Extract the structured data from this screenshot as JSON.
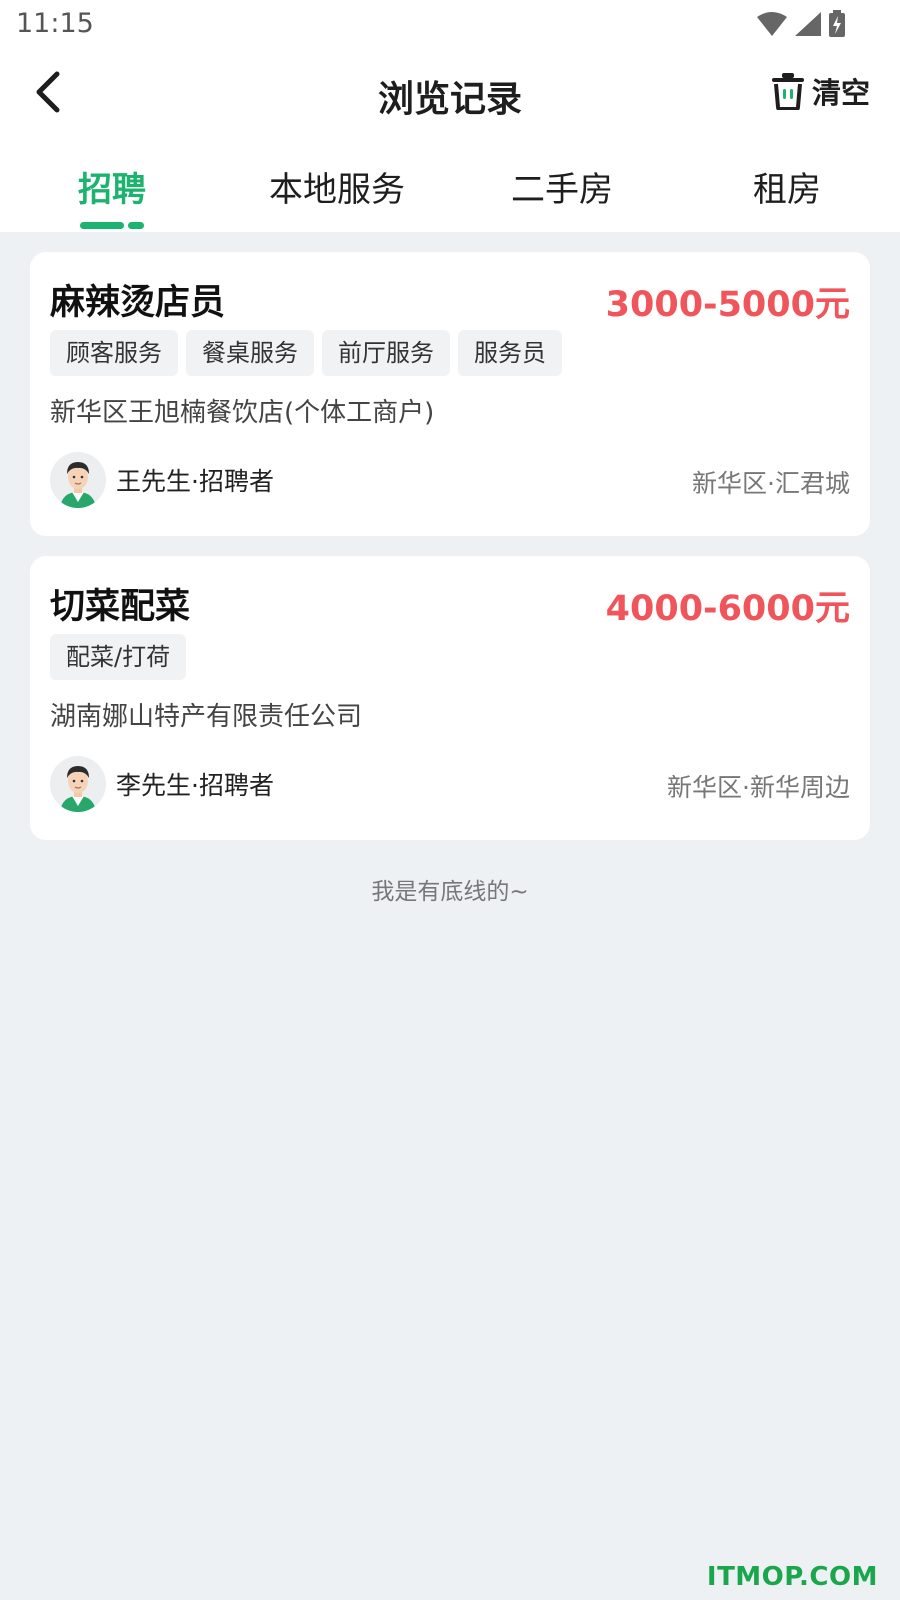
{
  "status_bar": {
    "time": "11:15"
  },
  "nav": {
    "title": "浏览记录",
    "clear_label": "清空"
  },
  "tabs": [
    {
      "label": "招聘",
      "active": true
    },
    {
      "label": "本地服务",
      "active": false
    },
    {
      "label": "二手房",
      "active": false
    },
    {
      "label": "租房",
      "active": false
    }
  ],
  "jobs": [
    {
      "title": "麻辣烫店员",
      "salary": "3000-5000元",
      "tags": [
        "顾客服务",
        "餐桌服务",
        "前厅服务",
        "服务员"
      ],
      "company": "新华区王旭楠餐饮店(个体工商户)",
      "recruiter": "王先生·招聘者",
      "location": "新华区·汇君城"
    },
    {
      "title": "切菜配菜",
      "salary": "4000-6000元",
      "tags": [
        "配菜/打荷"
      ],
      "company": "湖南娜山特产有限责任公司",
      "recruiter": "李先生·招聘者",
      "location": "新华区·新华周边"
    }
  ],
  "footer_note": "我是有底线的~",
  "watermark": "ITMOP.COM",
  "colors": {
    "accent": "#1cb36e",
    "salary": "#f0555b",
    "background": "#eef1f4"
  }
}
